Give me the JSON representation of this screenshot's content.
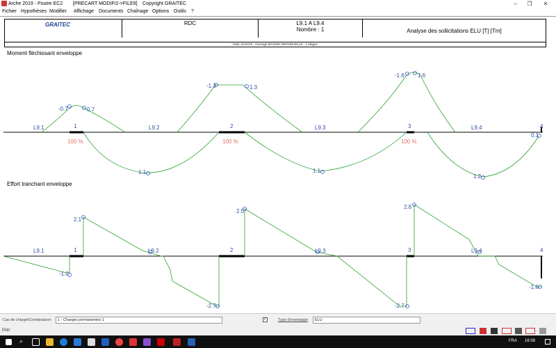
{
  "window": {
    "app_title": "Arche 2019 - Poutre EC2",
    "doc_title": "[PRECART MODIFI2->FILE9]",
    "copyright": "Copyright GRAITEC"
  },
  "menu": [
    "Fichier",
    "Hypothèses",
    "Modifier",
    "Affichage",
    "Documents",
    "Chaînage",
    "Options",
    "Outils",
    "?"
  ],
  "header": {
    "logo": "GRAITEC",
    "level": "RDC",
    "beam_range": "L9.1 A L9.4",
    "count": "Nombre : 1",
    "analysis": "Analyse des sollicitations ELU [T] [Tm]",
    "subline": "- Date 11/10/19 - Ouvrage MAISON INDIVIDUELLE - 1 étages -"
  },
  "moment": {
    "title": "Moment fléchissant enveloppe",
    "spans": [
      "L9.1",
      "L9.2",
      "L9.3",
      "L9.4"
    ],
    "supports": [
      "1",
      "2",
      "3",
      "4"
    ],
    "percents": [
      "100 %",
      "100 %",
      "100 %"
    ],
    "labels": [
      "-0.7",
      "0.7",
      "-1.3",
      "1.3",
      "-1.6",
      "1.6",
      "1.1",
      "1.1",
      "1.2",
      "0.1"
    ]
  },
  "shear": {
    "title": "Effort tranchant enveloppe",
    "spans": [
      "L9.1",
      "L9.2",
      "L9.3",
      "L9.4"
    ],
    "supports": [
      "1",
      "2",
      "3",
      "4"
    ],
    "labels": [
      "2.1",
      "-1.0",
      "2.5",
      "-2.7",
      "2.8",
      "-2.7",
      "-1.6"
    ]
  },
  "status": {
    "combo_label": "Cas de charge/Combinaison",
    "combo_value": "1 - Charges permanentes 1",
    "envelope_label": "Type d'enveloppe",
    "envelope_value": "ELU",
    "ready": "Prêt",
    "lang": "FRA",
    "time": "16:08"
  },
  "colors": {
    "curve": "#2ca02c",
    "marker": "#3050c8",
    "percent": "#e07060"
  }
}
